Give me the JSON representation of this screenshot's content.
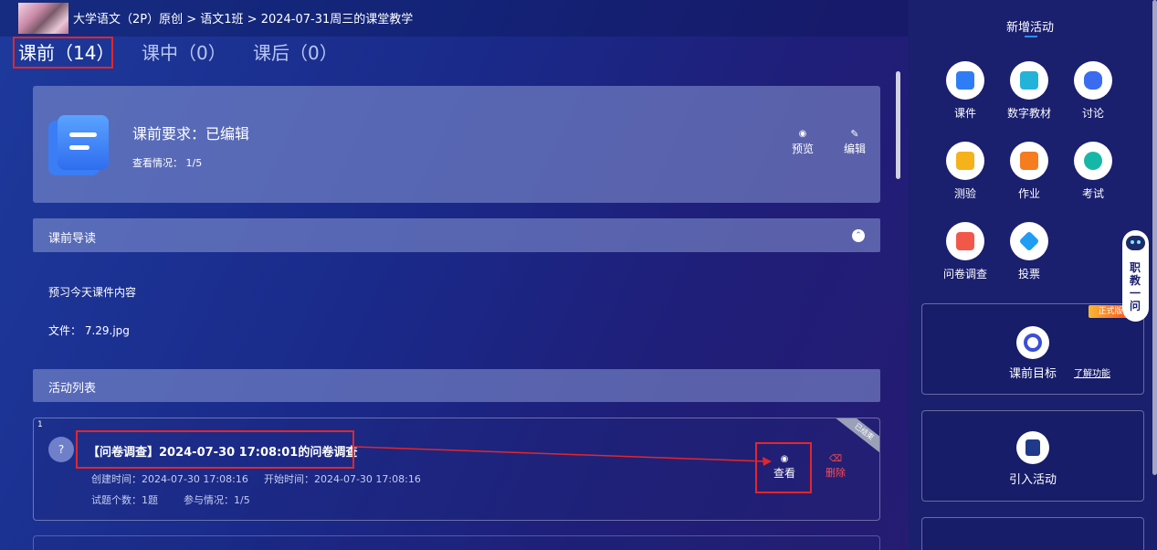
{
  "breadcrumb": "大学语文（2P）原创 > 语文1班 > 2024-07-31周三的课堂教学",
  "tabs": [
    {
      "label": "课前（14）",
      "active": true
    },
    {
      "label": "课中（0）",
      "active": false
    },
    {
      "label": "课后（0）",
      "active": false
    }
  ],
  "requirement": {
    "title": "课前要求：已编辑",
    "view_status": "查看情况：  1/5",
    "preview_label": "预览",
    "edit_label": "编辑"
  },
  "guide": {
    "header": "课前导读",
    "text": "预习今天课件内容",
    "file": "文件：  7.29.jpg"
  },
  "activity_list": {
    "header": "活动列表",
    "items": [
      {
        "index": "1",
        "ribbon": "已结束",
        "title": "【问卷调查】2024-07-30 17:08:01的问卷调查",
        "created": "创建时间：2024-07-30 17:08:16",
        "started": "开始时间：2024-07-30 17:08:16",
        "question_count": "试题个数：1题",
        "participation": "参与情况：1/5",
        "view_label": "查看",
        "delete_label": "删除"
      }
    ]
  },
  "sidebar": {
    "title": "新增活动",
    "activities": [
      {
        "label": "课件",
        "icon": "courseware-icon",
        "color": "#2f7df6"
      },
      {
        "label": "数字教材",
        "icon": "digital-textbook-icon",
        "color": "#23b3d9"
      },
      {
        "label": "讨论",
        "icon": "discussion-icon",
        "color": "#3b6cf0"
      },
      {
        "label": "测验",
        "icon": "quiz-icon",
        "color": "#f6b21b"
      },
      {
        "label": "作业",
        "icon": "homework-icon",
        "color": "#f57c1f"
      },
      {
        "label": "考试",
        "icon": "exam-icon",
        "color": "#15b8a6"
      },
      {
        "label": "问卷调查",
        "icon": "survey-icon",
        "color": "#f2584a"
      },
      {
        "label": "投票",
        "icon": "vote-icon",
        "color": "#1e9df2"
      }
    ],
    "goal_card": {
      "label": "课前目标",
      "link": "了解功能",
      "badge": "正式版"
    },
    "import_card": {
      "label": "引入活动"
    }
  },
  "assistant": {
    "text": "职教一问"
  }
}
